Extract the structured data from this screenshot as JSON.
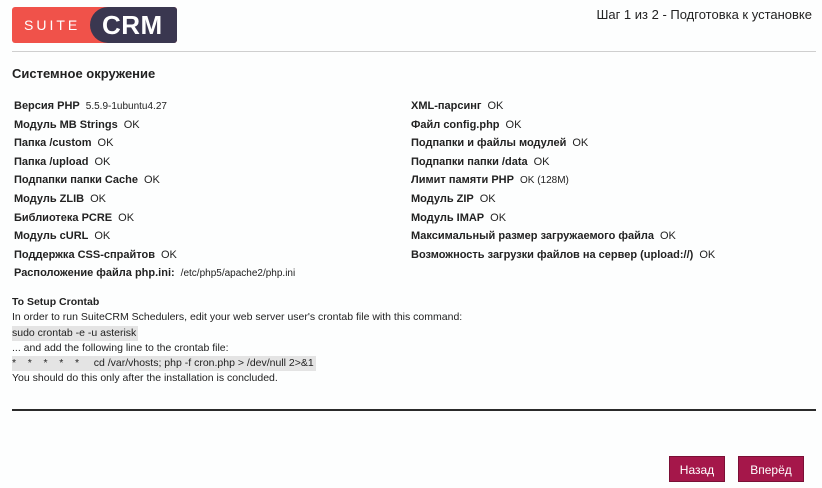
{
  "logo": {
    "suite": "SUITE",
    "crm": "CRM"
  },
  "header": {
    "step": "Шаг 1 из 2 - Подготовка к установке"
  },
  "section": {
    "title": "Системное окружение"
  },
  "left_checks": [
    {
      "label": "Версия PHP",
      "value": "5.5.9-1ubuntu4.27"
    },
    {
      "label": "Модуль MB Strings",
      "value": "OK"
    },
    {
      "label": "Папка /custom",
      "value": "OK"
    },
    {
      "label": "Папка /upload",
      "value": "OK"
    },
    {
      "label": "Подпапки папки Cache",
      "value": "OK"
    },
    {
      "label": "Модуль ZLIB",
      "value": "OK"
    },
    {
      "label": "Библиотека PCRE",
      "value": "OK"
    },
    {
      "label": "Модуль cURL",
      "value": "OK"
    },
    {
      "label": "Поддержка CSS-спрайтов",
      "value": "OK"
    },
    {
      "label": "Расположение файла php.ini:",
      "value": "/etc/php5/apache2/php.ini"
    }
  ],
  "right_checks": [
    {
      "label": "XML-парсинг",
      "value": "OK"
    },
    {
      "label": "Файл config.php",
      "value": "OK"
    },
    {
      "label": "Подпапки и файлы модулей",
      "value": "OK"
    },
    {
      "label": "Подпапки папки /data",
      "value": "OK"
    },
    {
      "label": "Лимит памяти PHP",
      "value": "OK (128M)"
    },
    {
      "label": "Модуль ZIP",
      "value": "OK"
    },
    {
      "label": "Модуль IMAP",
      "value": "OK"
    },
    {
      "label": "Максимальный размер загружаемого файла",
      "value": "OK"
    },
    {
      "label": "Возможность загрузки файлов на сервер (upload://)",
      "value": "OK"
    }
  ],
  "crontab": {
    "title": "To Setup Crontab",
    "intro": "In order to run SuiteCRM Schedulers, edit your web server user's crontab file with this command:",
    "command1": "sudo crontab -e -u asterisk",
    "add_line": "... and add the following line to the crontab file:",
    "command2": "*    *    *    *    *     cd /var/vhosts; php -f cron.php > /dev/null 2>&1",
    "note": "You should do this only after the installation is concluded."
  },
  "buttons": {
    "back": "Назад",
    "next": "Вперёд"
  }
}
